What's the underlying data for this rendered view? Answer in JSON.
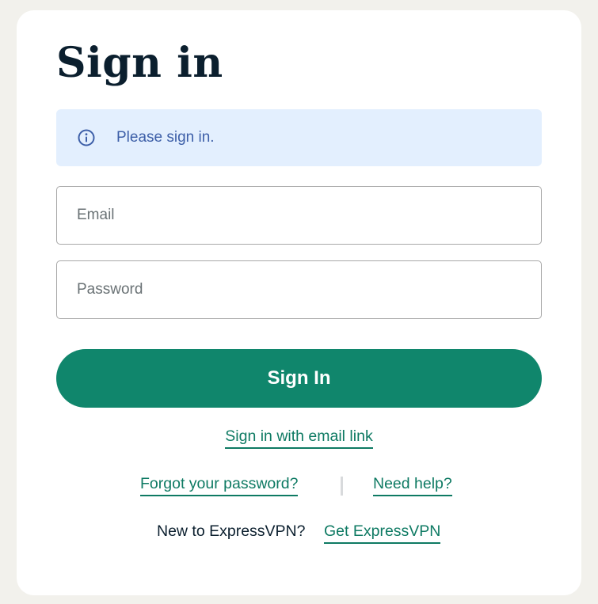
{
  "title": "Sign in",
  "notice": {
    "icon": "info-icon",
    "text": "Please sign in.",
    "background": "#e3effe",
    "text_color": "#3d5fa8"
  },
  "form": {
    "email": {
      "placeholder": "Email",
      "value": ""
    },
    "password": {
      "placeholder": "Password",
      "value": ""
    },
    "submit_label": "Sign In"
  },
  "links": {
    "email_link": "Sign in with email link",
    "forgot_password": "Forgot your password?",
    "need_help": "Need help?"
  },
  "signup": {
    "prompt": "New to ExpressVPN?",
    "link": "Get ExpressVPN"
  },
  "colors": {
    "accent": "#10866c",
    "link": "#0e7a63",
    "page_background": "#f2f1ec",
    "heading": "#0b1f2e"
  }
}
